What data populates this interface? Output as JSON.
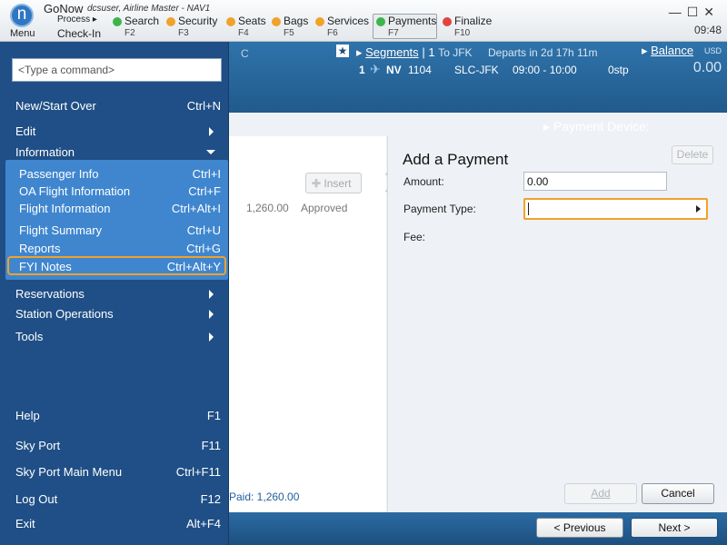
{
  "app": {
    "logo_letter": "n",
    "menu_label": "Menu",
    "name": "GoNow",
    "user_info": "dcsuser, Airline Master - NAV1",
    "process_label": "Process",
    "checkin_label": "Check-In",
    "clock": "09:48"
  },
  "steps": [
    {
      "label": "Search",
      "key": "F2",
      "color": "#3cb44b"
    },
    {
      "label": "Security",
      "key": "F3",
      "color": "#f0a22a"
    },
    {
      "label": "Seats",
      "key": "F4",
      "color": "#f0a22a"
    },
    {
      "label": "Bags",
      "key": "F5",
      "color": "#f0a22a"
    },
    {
      "label": "Services",
      "key": "F6",
      "color": "#f0a22a"
    },
    {
      "label": "Payments",
      "key": "F7",
      "color": "#3cb44b"
    },
    {
      "label": "Finalize",
      "key": "F10",
      "color": "#e0443e"
    }
  ],
  "header": {
    "c_label": "C",
    "segments_label": "Segments",
    "segments_sep": "|",
    "segments_count": "1",
    "to": "To JFK",
    "departs": "Departs in 2d 17h 11m",
    "balance_label": "Balance",
    "currency": "USD",
    "balance": "0.00",
    "flight": {
      "index": "1",
      "carrier": "NV",
      "number": "1104",
      "route": "SLC-JFK",
      "times": "09:00 - 10:00",
      "stops": "0stp"
    },
    "payment_device_label": "Payment Device:"
  },
  "left_panel": {
    "insert_label": "Insert",
    "row_amount": "1,260.00",
    "row_status": "Approved",
    "paid": "Paid:  1,260.00"
  },
  "payment": {
    "title": "Add a Payment",
    "delete_label": "Delete",
    "amount_label": "Amount:",
    "amount_value": "0.00",
    "payment_type_label": "Payment Type:",
    "fee_label": "Fee:",
    "add_label": "Add",
    "cancel_label": "Cancel"
  },
  "nav": {
    "previous_label": "< Previous",
    "next_label": "Next >"
  },
  "side_menu": {
    "command_placeholder": "<Type a command>",
    "items": [
      {
        "label": "New/Start Over",
        "shortcut": "Ctrl+N"
      },
      {
        "label": "Edit",
        "shortcut": ""
      },
      {
        "label": "Information",
        "shortcut": ""
      },
      {
        "label": "Reservations",
        "shortcut": ""
      },
      {
        "label": "Station Operations",
        "shortcut": ""
      },
      {
        "label": "Tools",
        "shortcut": ""
      },
      {
        "label": "Help",
        "shortcut": "F1"
      },
      {
        "label": "Sky Port",
        "shortcut": "F11"
      },
      {
        "label": "Sky Port Main Menu",
        "shortcut": "Ctrl+F11"
      },
      {
        "label": "Log Out",
        "shortcut": "F12"
      },
      {
        "label": "Exit",
        "shortcut": "Alt+F4"
      }
    ],
    "information_sub": [
      {
        "label": "Passenger Info",
        "shortcut": "Ctrl+I"
      },
      {
        "label": "OA Flight Information",
        "shortcut": "Ctrl+F"
      },
      {
        "label": "Flight Information",
        "shortcut": "Ctrl+Alt+I"
      },
      {
        "label": "Flight Summary",
        "shortcut": "Ctrl+U"
      },
      {
        "label": "Reports",
        "shortcut": "Ctrl+G"
      },
      {
        "label": "FYI Notes",
        "shortcut": "Ctrl+Alt+Y"
      }
    ]
  }
}
